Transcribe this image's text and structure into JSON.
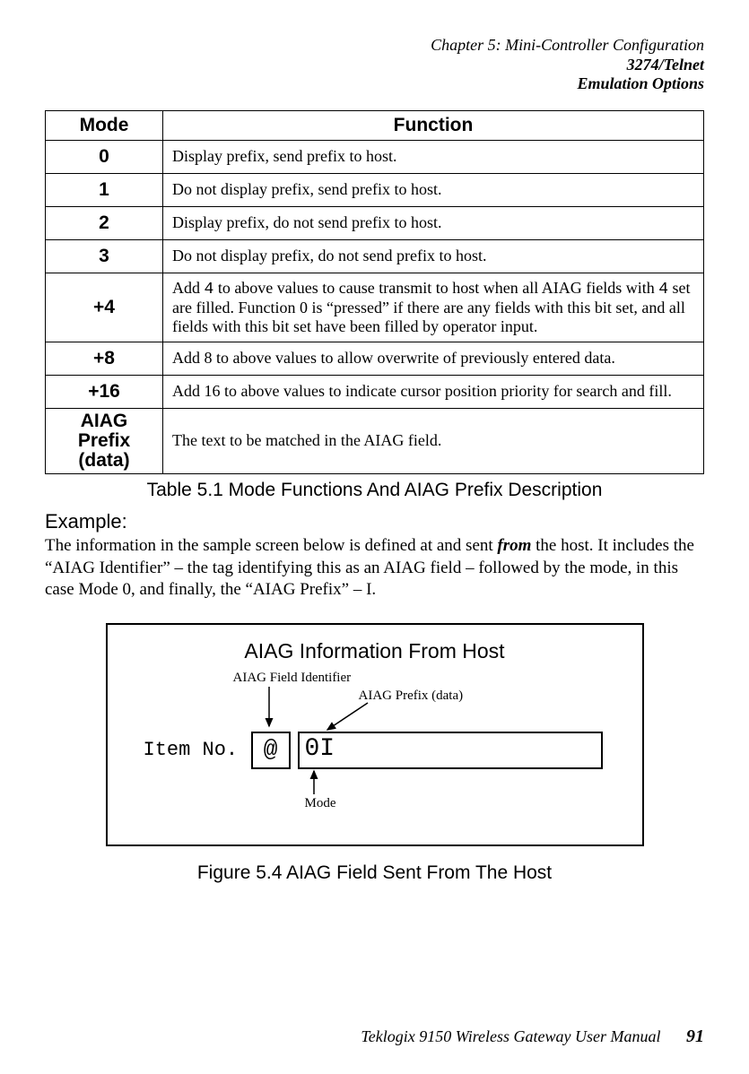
{
  "header": {
    "line1": "Chapter 5:  Mini-Controller Configuration",
    "line2": "3274/Telnet",
    "line3": "Emulation Options"
  },
  "table": {
    "headers": {
      "mode": "Mode",
      "function": "Function"
    },
    "rows": [
      {
        "mode": "0",
        "func": "Display prefix, send prefix to host."
      },
      {
        "mode": "1",
        "func": "Do not display prefix, send prefix to host."
      },
      {
        "mode": "2",
        "func": "Display prefix, do not send prefix to host."
      },
      {
        "mode": "3",
        "func": "Do not display prefix, do not send prefix to host."
      },
      {
        "mode": "+4",
        "func_pre": "Add ",
        "func_mono1": "4",
        "func_mid": " to above values to cause transmit to host when all AIAG fields with ",
        "func_mono2": "4",
        "func_post": " set are filled. Function 0 is “pressed” if there are any fields with this bit set, and all fields with this bit set have been filled by operator input."
      },
      {
        "mode": "+8",
        "func": "Add 8 to above values to allow overwrite of previously entered data."
      },
      {
        "mode": "+16",
        "func": "Add 16 to above values to indicate cursor position priority for search and fill."
      },
      {
        "mode_l1": "AIAG Prefix",
        "mode_l2": "(data)",
        "func": "The text to be matched in the AIAG field."
      }
    ],
    "caption": "Table 5.1 Mode Functions And AIAG Prefix Description"
  },
  "example": {
    "label": "Example:",
    "para_pre": "The information in the sample screen below is defined at and sent ",
    "para_from": "from",
    "para_post": " the host. It includes the “AIAG Identifier” – the tag identifying this as an AIAG field – followed by the mode, in this case Mode 0, and finally, the “AIAG Prefix” – I."
  },
  "figure": {
    "title": "AIAG Information From Host",
    "labels": {
      "field_identifier": "AIAG Field Identifier",
      "prefix": "AIAG Prefix (data)",
      "mode": "Mode"
    },
    "item_label": "Item No.",
    "at_symbol": "@",
    "box_text": "0I",
    "caption": "Figure 5.4 AIAG Field Sent From The Host"
  },
  "footer": {
    "text": "Teklogix 9150 Wireless Gateway User Manual",
    "page": "91"
  }
}
